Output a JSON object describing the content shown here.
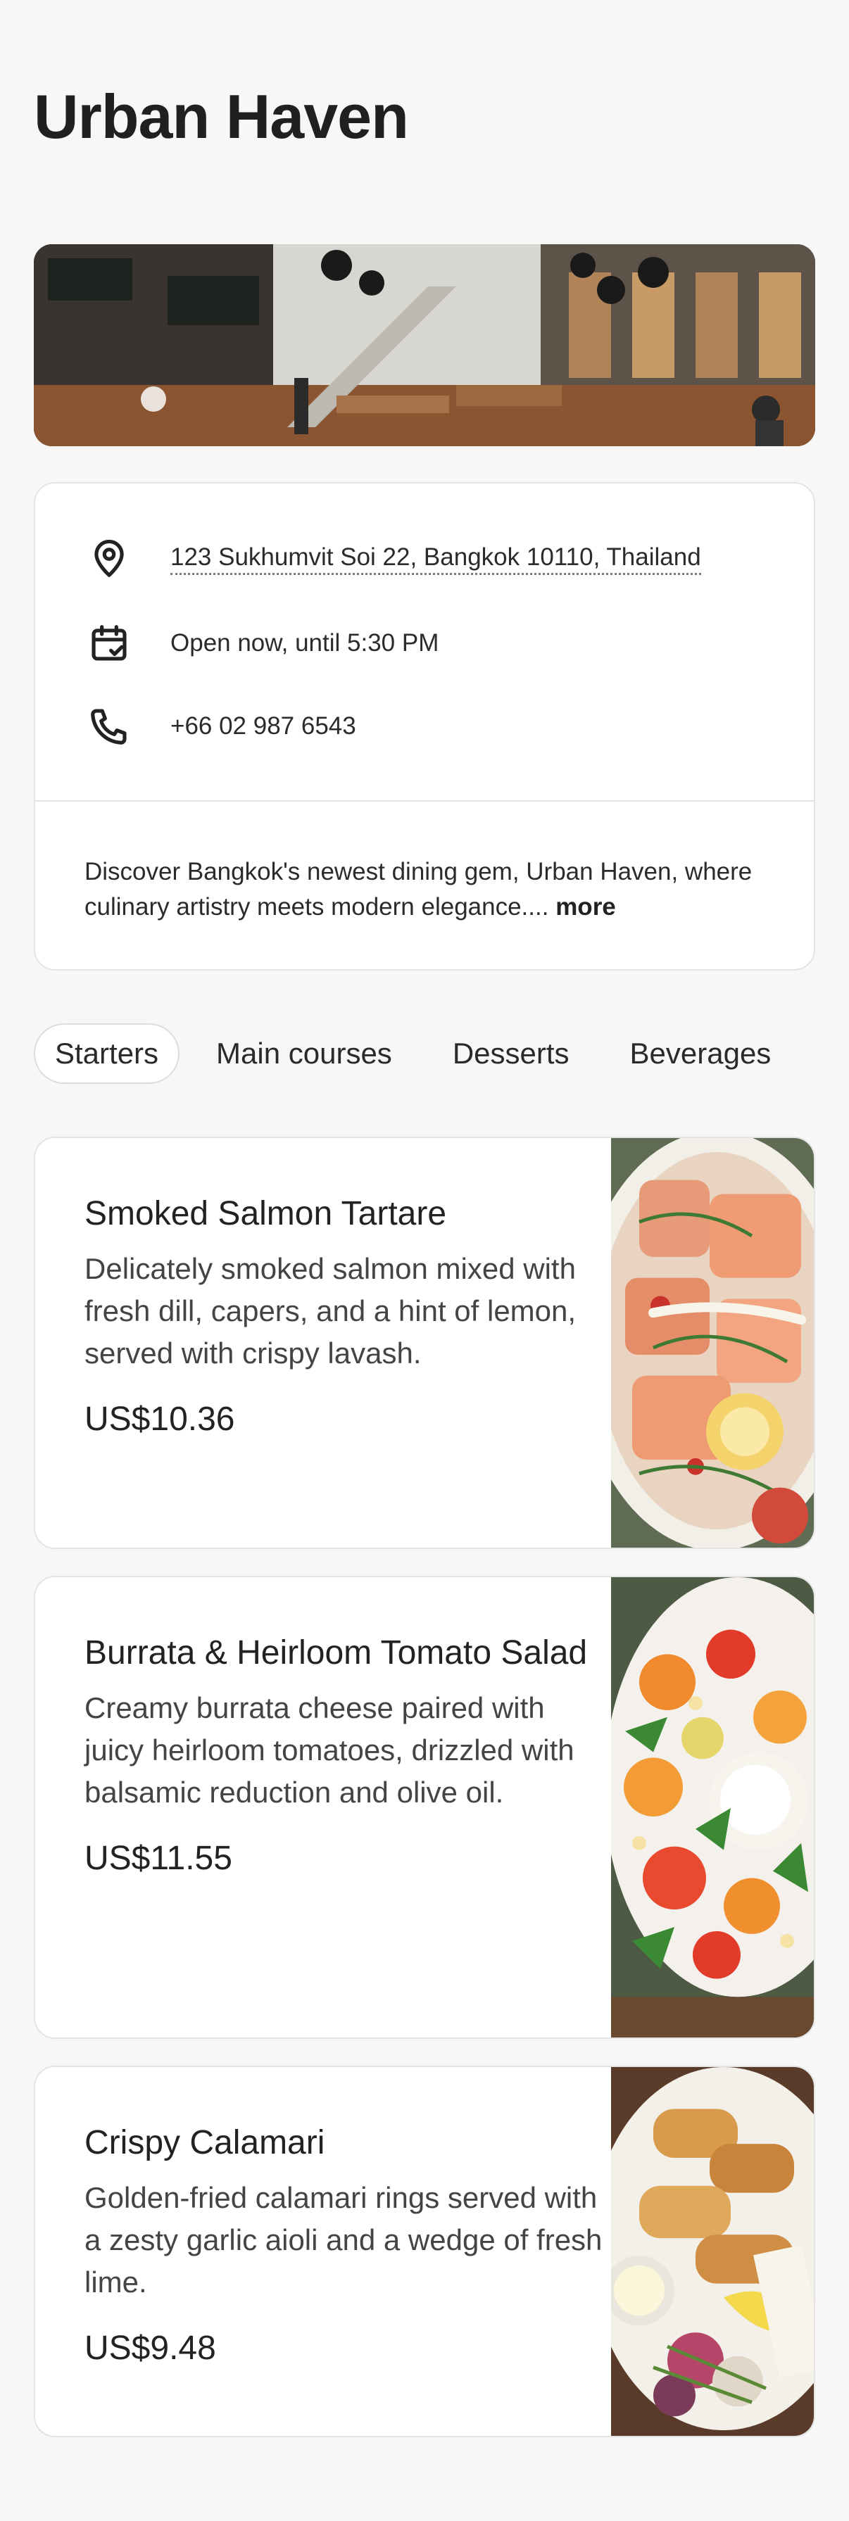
{
  "restaurant": {
    "name": "Urban Haven"
  },
  "info": {
    "address": "123 Sukhumvit Soi 22, Bangkok 10110, Thailand",
    "hours": "Open now, until 5:30 PM",
    "phone": "+66 02 987 6543",
    "description": "Discover Bangkok's newest dining gem, Urban Haven, where culinary artistry meets modern elegance....",
    "more_label": "more"
  },
  "tabs": [
    {
      "label": "Starters",
      "active": true
    },
    {
      "label": "Main courses",
      "active": false
    },
    {
      "label": "Desserts",
      "active": false
    },
    {
      "label": "Beverages",
      "active": false
    }
  ],
  "menu": [
    {
      "name": "Smoked Salmon Tartare",
      "description": "Delicately smoked salmon mixed with fresh dill, capers, and a hint of lemon, served with crispy lavash.",
      "price": "US$10.36"
    },
    {
      "name": "Burrata & Heirloom Tomato Salad",
      "description": "Creamy burrata cheese paired with juicy heirloom tomatoes, drizzled with balsamic reduction and olive oil.",
      "price": "US$11.55"
    },
    {
      "name": "Crispy Calamari",
      "description": "Golden-fried calamari rings served with a zesty garlic aioli and a wedge of fresh lime.",
      "price": "US$9.48"
    }
  ],
  "icons": {
    "address": "location-pin-icon",
    "hours": "calendar-check-icon",
    "phone": "phone-icon"
  }
}
